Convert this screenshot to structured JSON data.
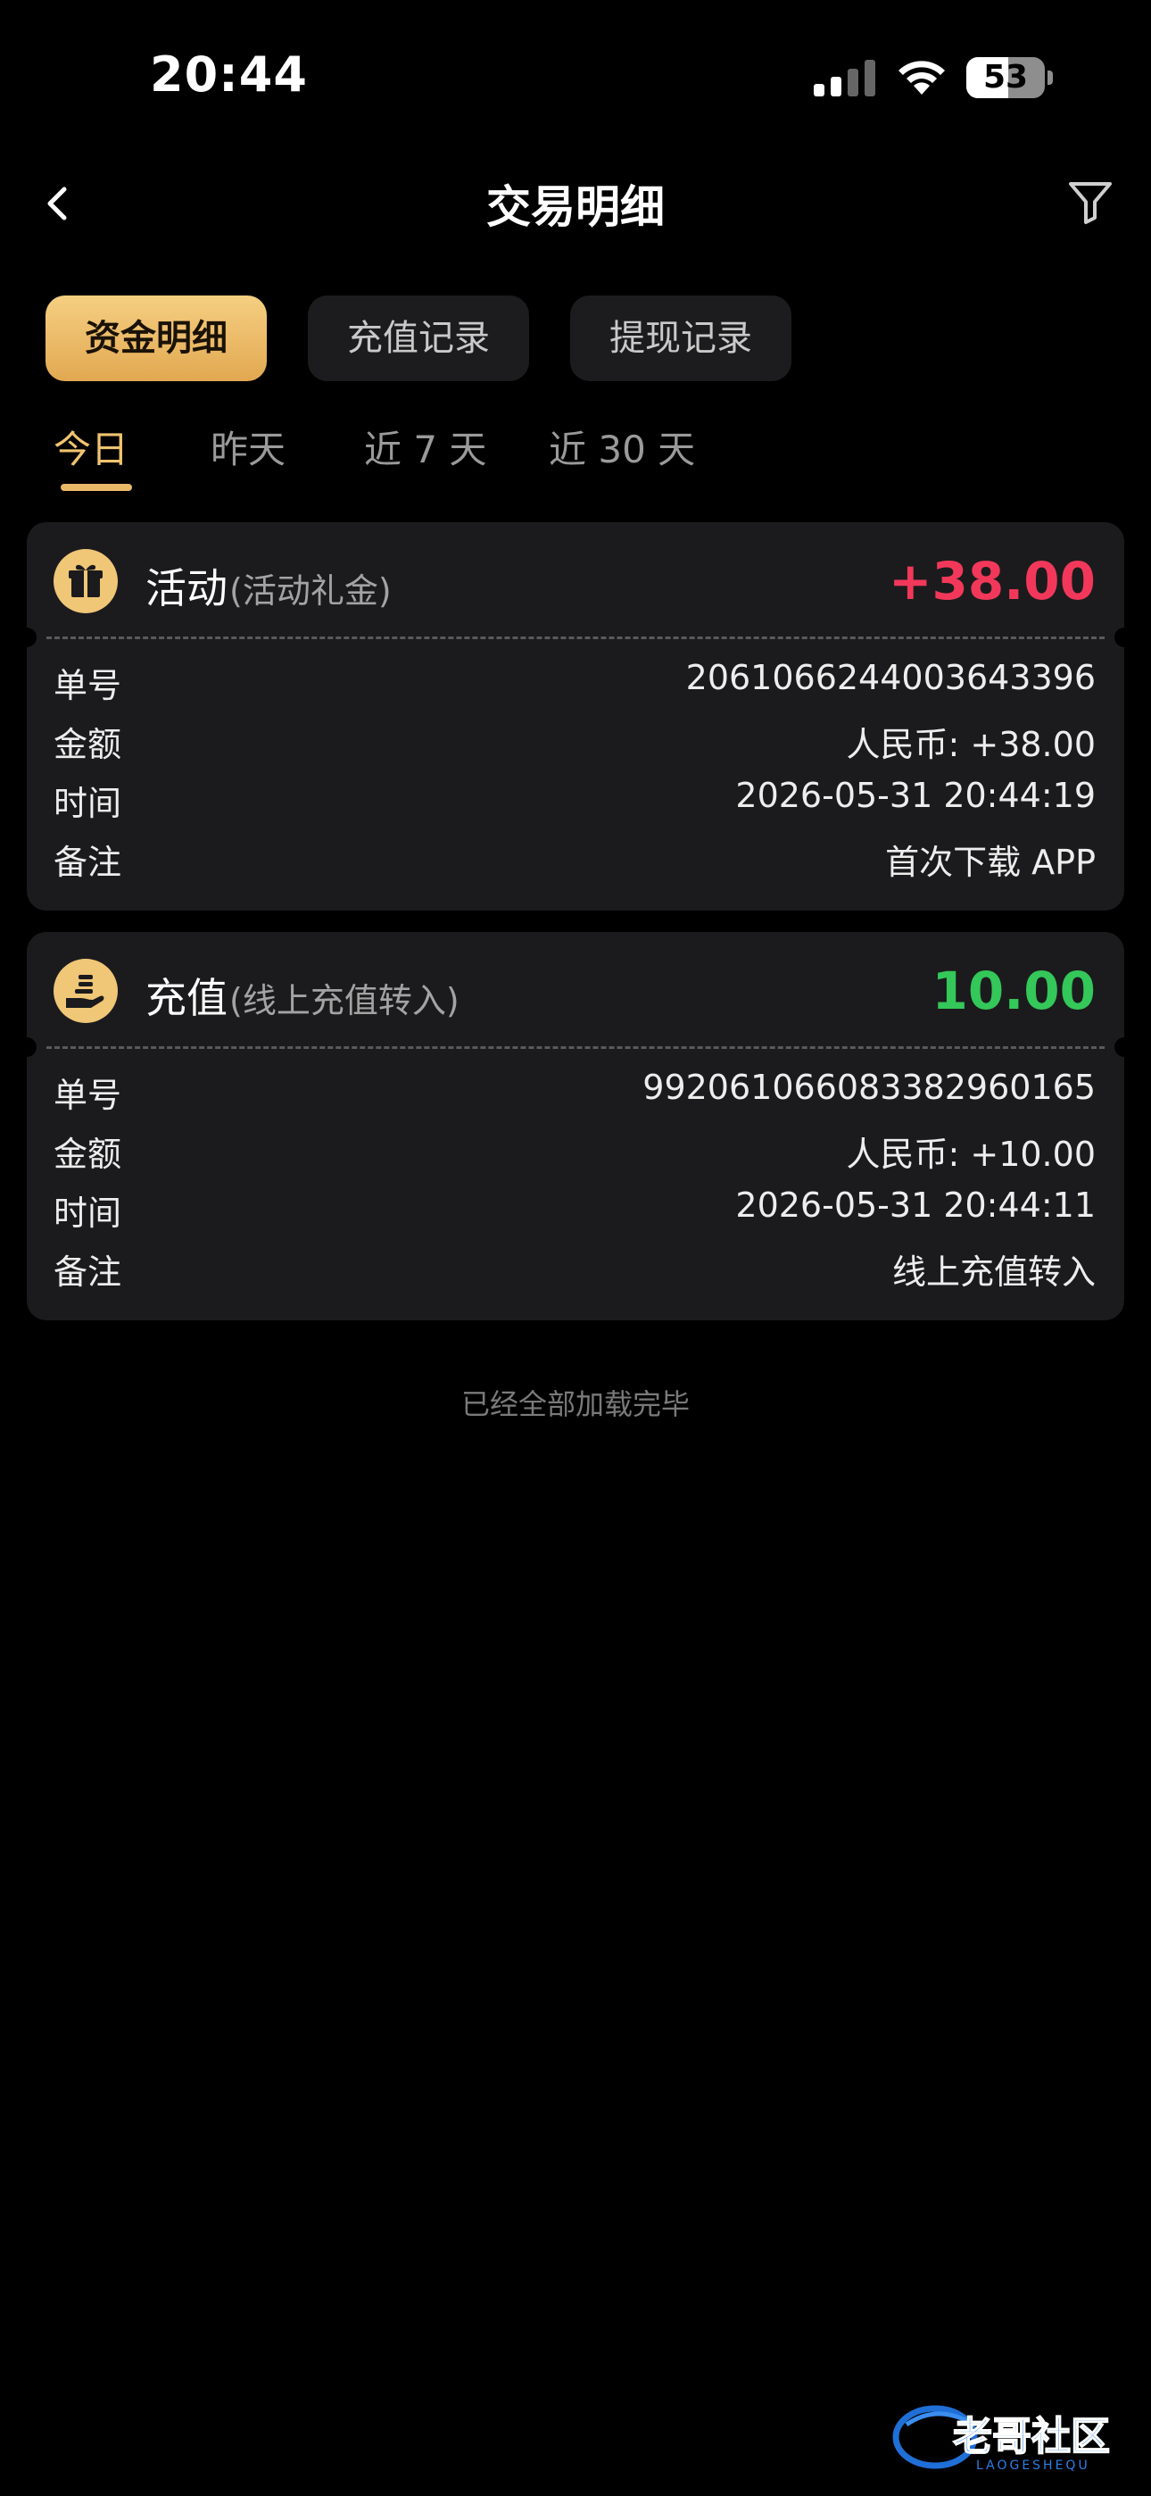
{
  "status_bar": {
    "time": "20:44",
    "battery": "53",
    "battery_level": 0.53
  },
  "header": {
    "title": "交易明细"
  },
  "category_tabs": [
    {
      "label": "资金明细",
      "active": true
    },
    {
      "label": "充值记录",
      "active": false
    },
    {
      "label": "提现记录",
      "active": false
    }
  ],
  "date_filters": [
    {
      "label": "今日",
      "active": true
    },
    {
      "label": "昨天",
      "active": false
    },
    {
      "label": "近 7 天",
      "active": false
    },
    {
      "label": "近 30 天",
      "active": false
    }
  ],
  "transactions": [
    {
      "icon": "gift-icon",
      "type": "活动",
      "subtype": "(活动礼金)",
      "amount": "+38.00",
      "amount_color": "#f2385a",
      "rows": [
        {
          "label": "单号",
          "value": "2061066244003643396"
        },
        {
          "label": "金额",
          "value": "人民币: +38.00"
        },
        {
          "label": "时间",
          "value": "2026-05-31 20:44:19"
        },
        {
          "label": "备注",
          "value": "首次下载 APP"
        }
      ]
    },
    {
      "icon": "deposit-hand-icon",
      "type": "充值",
      "subtype": "(线上充值转入)",
      "amount": "10.00",
      "amount_color": "#34c759",
      "rows": [
        {
          "label": "单号",
          "value": "992061066083382960165"
        },
        {
          "label": "金额",
          "value": "人民币: +10.00"
        },
        {
          "label": "时间",
          "value": "2026-05-31 20:44:11"
        },
        {
          "label": "备注",
          "value": "线上充值转入"
        }
      ]
    }
  ],
  "footer": {
    "note": "已经全部加载完毕"
  },
  "watermark": {
    "text": "老哥社区",
    "subtext": "LAOGESHEQU"
  },
  "colors": {
    "accent": "#e9b967",
    "card_bg": "#1b1b1d",
    "page_bg": "#000000"
  }
}
